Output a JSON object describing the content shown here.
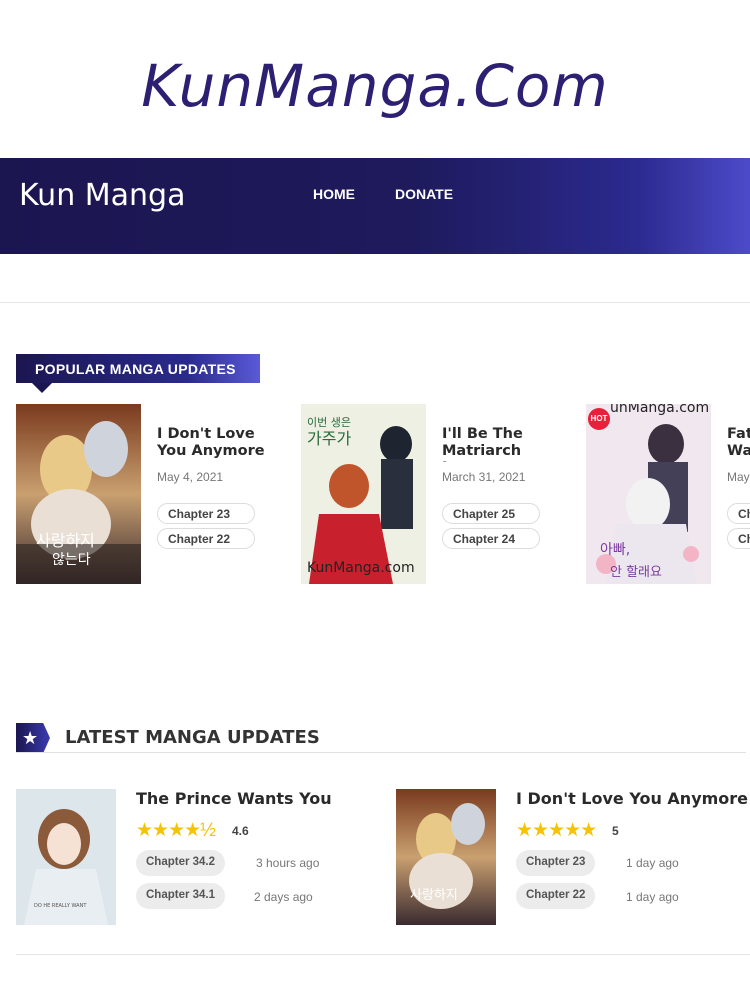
{
  "logo": {
    "text": "KunManga.Com"
  },
  "header": {
    "site_name": "Kun Manga",
    "nav": [
      "HOME",
      "DONATE"
    ]
  },
  "popular": {
    "heading": "POPULAR MANGA UPDATES",
    "cards": [
      {
        "title": "I Don't Love You Anymore",
        "date": "May 4, 2021",
        "chapters": [
          "Chapter 23",
          "Chapter 22"
        ],
        "badge": "",
        "cover_text": ""
      },
      {
        "title": "I'll Be The Matriarch In...",
        "date": "March 31, 2021",
        "chapters": [
          "Chapter 25",
          "Chapter 24"
        ],
        "badge": "",
        "cover_text": "KunManga.com"
      },
      {
        "title": "Fat",
        "title_line2": "Wa",
        "date": "May",
        "chapters": [
          "Ch",
          "Ch"
        ],
        "badge": "HOT",
        "cover_text": "unManga.com"
      }
    ]
  },
  "latest": {
    "heading": "LATEST MANGA UPDATES",
    "items": [
      {
        "title": "The Prince Wants You",
        "stars": "★★★★½",
        "rating": "4.6",
        "chapters": [
          {
            "label": "Chapter 34.2",
            "time": "3 hours ago"
          },
          {
            "label": "Chapter 34.1",
            "time": "2 days ago"
          }
        ]
      },
      {
        "title": "I Don't Love You Anymore",
        "stars": "★★★★★",
        "rating": "5",
        "chapters": [
          {
            "label": "Chapter 23",
            "time": "1 day ago"
          },
          {
            "label": "Chapter 22",
            "time": "1 day ago"
          }
        ]
      }
    ]
  },
  "colors": {
    "brand_dark": "#1b1650",
    "brand_accent": "#4d4bc9",
    "star": "#f5c400",
    "hot": "#e8203b"
  }
}
